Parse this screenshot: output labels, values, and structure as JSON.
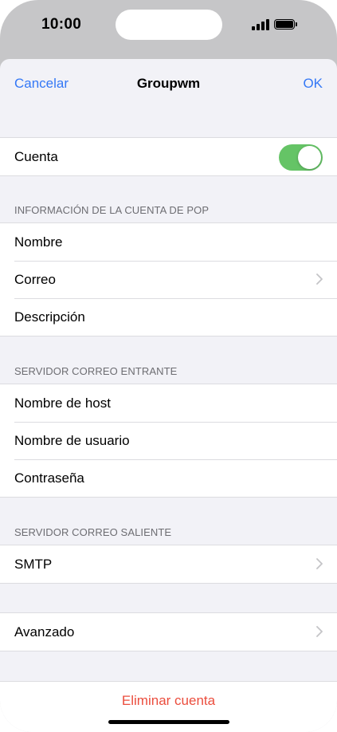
{
  "status_bar": {
    "time": "10:00"
  },
  "nav": {
    "cancel": "Cancelar",
    "title": "Groupwm",
    "ok": "OK"
  },
  "account_group": {
    "label": "Cuenta",
    "toggle_on": true
  },
  "pop_section": {
    "header": "INFORMACIÓN DE LA CUENTA DE POP",
    "rows": [
      "Nombre",
      "Correo",
      "Descripción"
    ]
  },
  "incoming_section": {
    "header": "SERVIDOR CORREO ENTRANTE",
    "rows": [
      "Nombre de host",
      "Nombre de usuario",
      "Contraseña"
    ]
  },
  "outgoing_section": {
    "header": "SERVIDOR CORREO SALIENTE",
    "rows": [
      "SMTP"
    ]
  },
  "advanced": {
    "label": "Avanzado"
  },
  "delete": {
    "label": "Eliminar cuenta"
  },
  "colors": {
    "accent": "#3478f6",
    "toggle": "#65c466",
    "destructive": "#eb4d3d"
  }
}
